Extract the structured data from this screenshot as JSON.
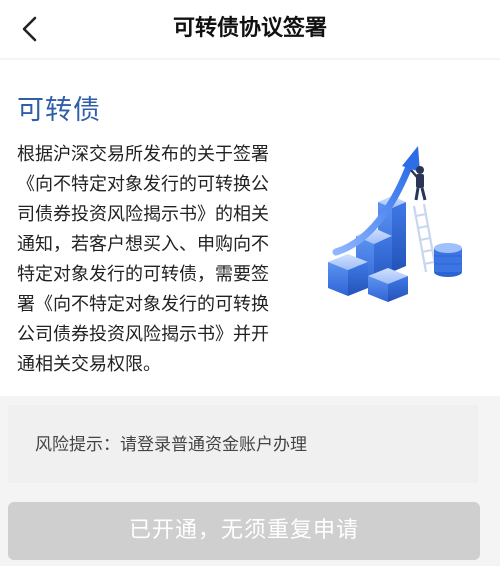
{
  "header": {
    "title": "可转债协议签署",
    "back_icon": "chevron-left-icon"
  },
  "card": {
    "title": "可转债",
    "lines": [
      "根据沪深交易所发布的关于签署",
      "《向不特定对象发行的可转换公",
      "司债券投资风险揭示书》的相关",
      "通知，若客户想买入、申购向不",
      "特定对象发行的可转债，需要签",
      "署《向不特定对象发行的可转换",
      "公司债券投资风险揭示书》并开",
      "通相关交易权限。"
    ],
    "illustration_icon": "growth-chart-illustration",
    "colors": {
      "title": "#2f5fa8",
      "accent": "#3f7be8"
    }
  },
  "risk": {
    "text": "风险提示：请登录普通资金账户办理"
  },
  "action": {
    "label": "已开通，无须重复申请"
  }
}
